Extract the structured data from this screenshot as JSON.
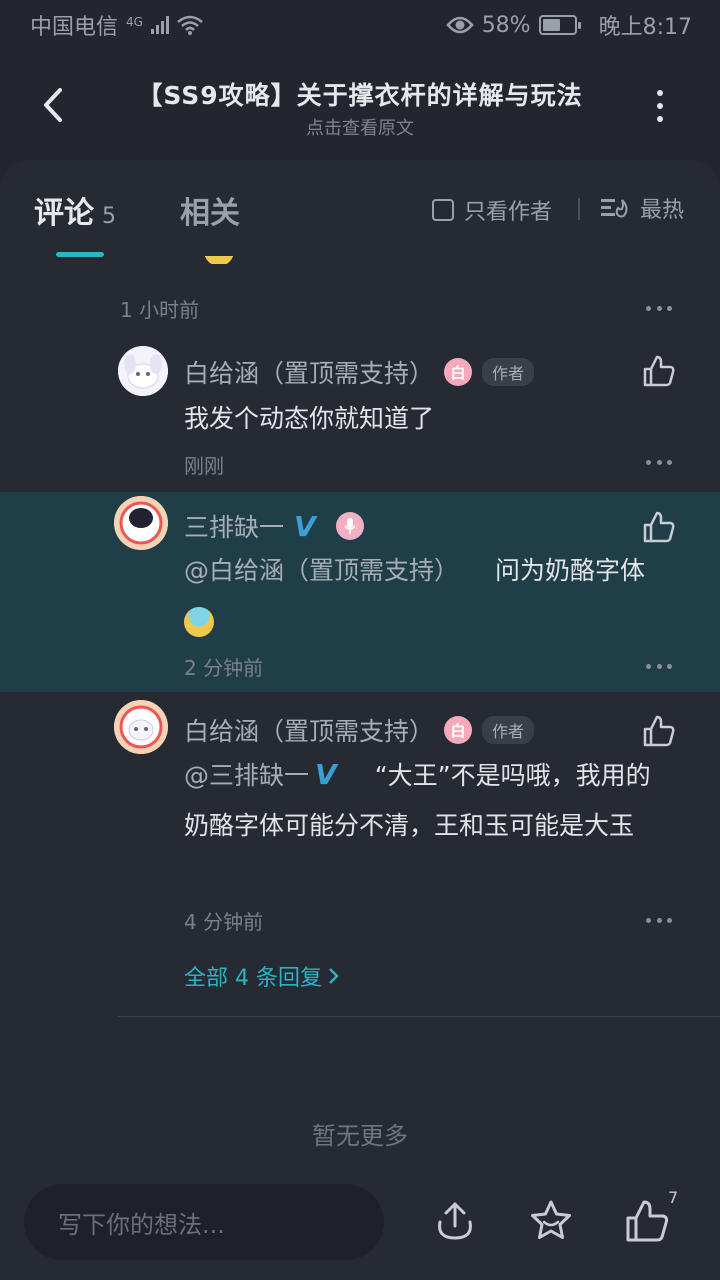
{
  "status_bar": {
    "carrier": "中国电信",
    "network": "4G",
    "battery": "58%",
    "battery_level": 0.58,
    "time": "晚上8:17"
  },
  "header": {
    "title": "【SS9攻略】关于撑衣杆的详解与玩法",
    "subtitle": "点击查看原文",
    "back_icon": "back-arrow-icon",
    "more_icon": "more-vertical-icon"
  },
  "tabs": {
    "comments_label": "评论",
    "comments_count": "5",
    "related_label": "相关",
    "author_only_label": "只看作者",
    "sort_label": "最热"
  },
  "comments": [
    {
      "time": "1 小时前"
    },
    {
      "name": "白给涵（置顶需支持）",
      "author_badge": "作者",
      "text": "我发个动态你就知道了",
      "time": "刚刚"
    },
    {
      "name": "三排缺一",
      "verified": "V",
      "mention": "@白给涵（置顶需支持）",
      "text": "问为奶酪字体",
      "time": "2 分钟前"
    },
    {
      "name": "白给涵（置顶需支持）",
      "author_badge": "作者",
      "mention": "@三排缺一",
      "verified": "V",
      "text": "“大王”不是吗哦，我用的奶酪字体可能分不清，王和玉可能是大玉",
      "time": "4 分钟前"
    }
  ],
  "more_replies": "全部 4 条回复",
  "no_more": "暂无更多",
  "bottom_bar": {
    "input_placeholder": "写下你的想法...",
    "like_count": "7"
  },
  "colors": {
    "background": "#23262f",
    "accent": "#2bb5c4",
    "highlight": "#1f3e48",
    "badge_pink": "#f6a9b9"
  }
}
